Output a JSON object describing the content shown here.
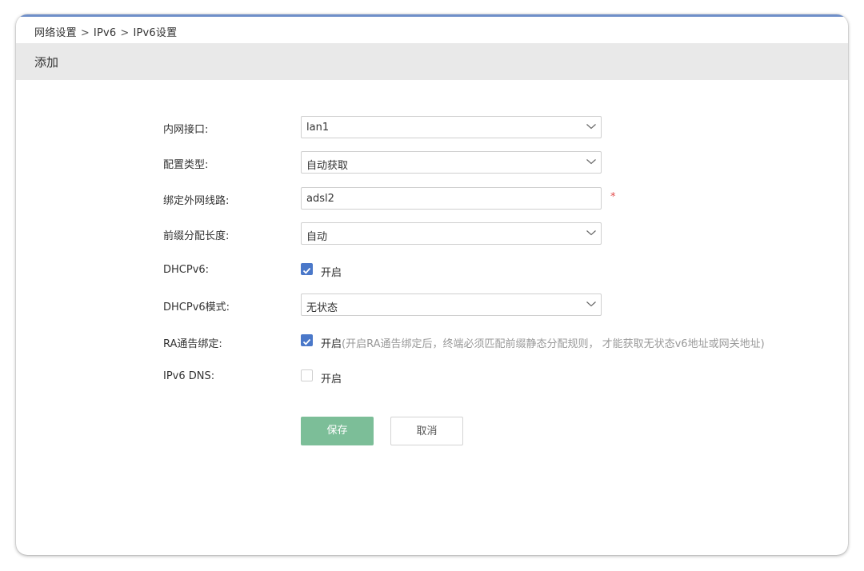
{
  "breadcrumb": {
    "items": [
      "网络设置",
      "IPv6",
      "IPv6设置"
    ],
    "separator": ">"
  },
  "section": {
    "title": "添加"
  },
  "form": {
    "lan_interface": {
      "label": "内网接口:",
      "value": "lan1"
    },
    "config_type": {
      "label": "配置类型:",
      "value": "自动获取"
    },
    "bind_wan_line": {
      "label": "绑定外网线路:",
      "value": "adsl2",
      "required_mark": "*"
    },
    "prefix_length": {
      "label": "前缀分配长度:",
      "value": "自动"
    },
    "dhcpv6": {
      "label": "DHCPv6:",
      "option_label": "开启",
      "checked": true
    },
    "dhcpv6_mode": {
      "label": "DHCPv6模式:",
      "value": "无状态"
    },
    "ra_bind": {
      "label": "RA通告绑定:",
      "option_label": "开启",
      "checked": true,
      "hint": "(开启RA通告绑定后，终端必须匹配前缀静态分配规则， 才能获取无状态v6地址或网关地址)"
    },
    "ipv6_dns": {
      "label": "IPv6 DNS:",
      "option_label": "开启",
      "checked": false
    }
  },
  "buttons": {
    "save_label": "保存",
    "cancel_label": "取消"
  },
  "colors": {
    "accent_blue": "#4a78c9",
    "save_green": "#7cbe98",
    "required_red": "#e24a4a",
    "header_gray": "#e9e9e9"
  },
  "icons": {
    "select_arrow": "chevron-down-icon",
    "checkmark": "check-icon"
  }
}
